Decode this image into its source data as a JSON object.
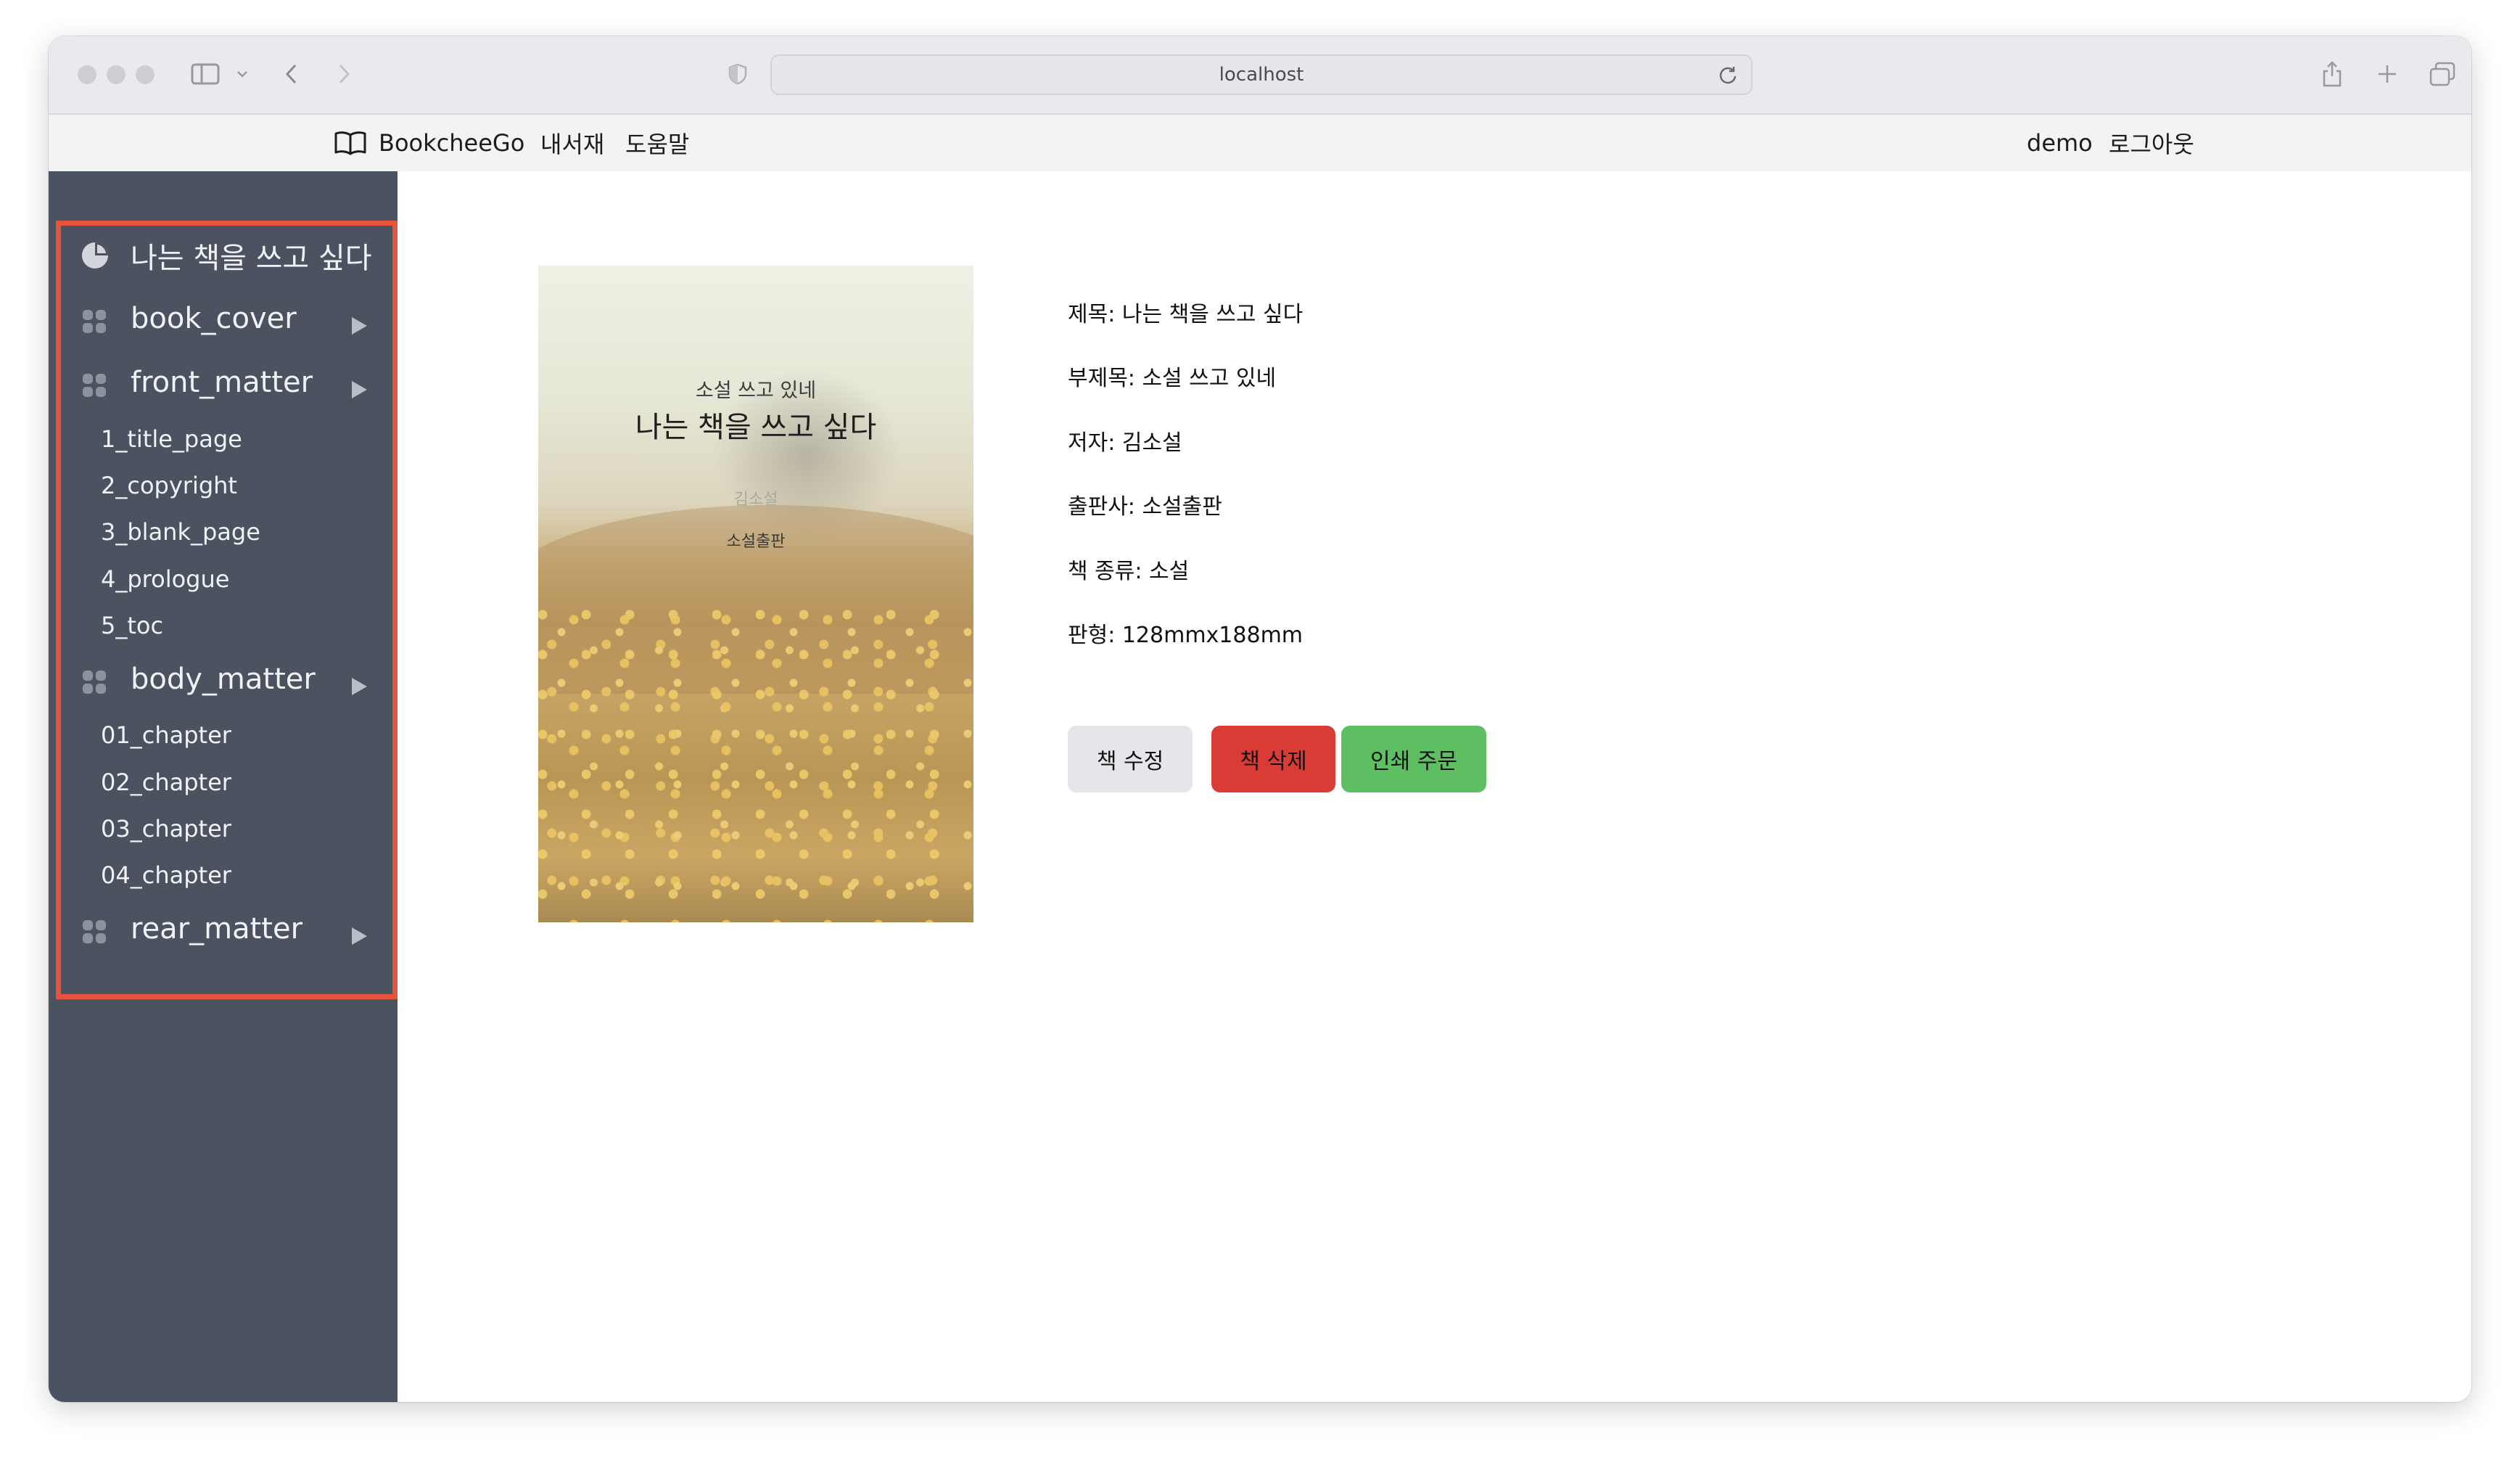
{
  "browser": {
    "url": "localhost"
  },
  "navbar": {
    "brand": "BookcheeGo",
    "links": [
      "내서재",
      "도움말"
    ],
    "user": "demo",
    "logout": "로그아웃"
  },
  "sidebar": {
    "book_title": "나는 책을 쓰고 싶다",
    "sections": [
      {
        "label": "book_cover",
        "items": []
      },
      {
        "label": "front_matter",
        "items": [
          "1_title_page",
          "2_copyright",
          "3_blank_page",
          "4_prologue",
          "5_toc"
        ]
      },
      {
        "label": "body_matter",
        "items": [
          "01_chapter",
          "02_chapter",
          "03_chapter",
          "04_chapter"
        ]
      },
      {
        "label": "rear_matter",
        "items": []
      }
    ]
  },
  "cover": {
    "subtitle": "소설 쓰고 있네",
    "title": "나는 책을 쓰고 싶다",
    "author": "김소설",
    "publisher": "소설출판"
  },
  "details": {
    "title": "제목: 나는 책을 쓰고 싶다",
    "subtitle": "부제목: 소설 쓰고 있네",
    "author": "저자: 김소설",
    "publisher": "출판사: 소설출판",
    "genre": "책 종류: 소설",
    "format": "판형: 128mmx188mm"
  },
  "actions": {
    "edit": "책 수정",
    "delete": "책 삭제",
    "print": "인쇄 주문"
  },
  "colors": {
    "sidebar_bg": "#4b5260",
    "highlight": "#e8533c",
    "delete_button": "#d93c35",
    "print_button": "#5dbf62",
    "edit_button": "#e5e6ea"
  }
}
